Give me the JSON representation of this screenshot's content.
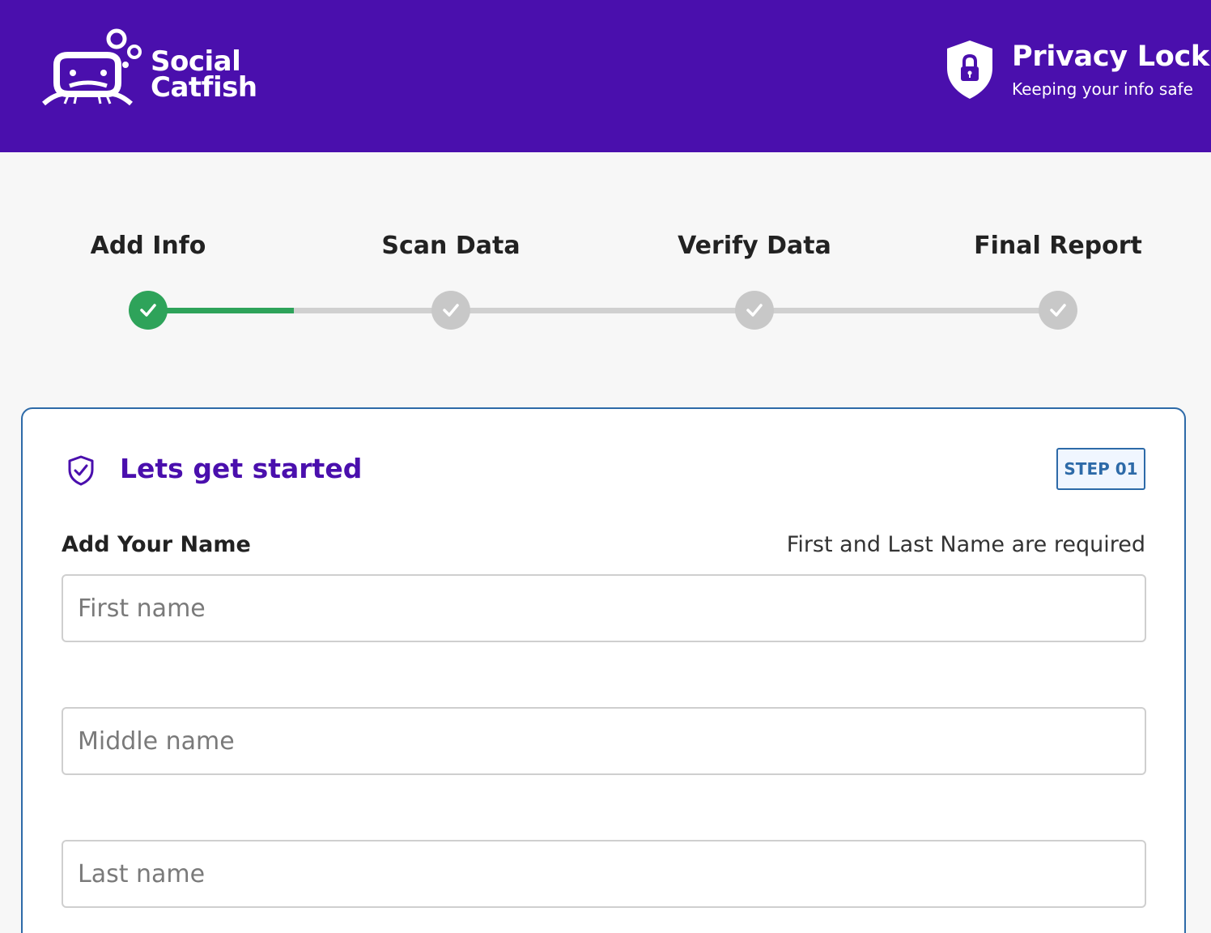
{
  "header": {
    "logo_line1": "Social",
    "logo_line2": "Catfish",
    "privacy_title": "Privacy Lock",
    "privacy_subtitle": "Keeping your info safe",
    "background": "#4a0fad"
  },
  "progress": {
    "steps": [
      {
        "label": "Add Info",
        "done": true
      },
      {
        "label": "Scan Data",
        "done": false
      },
      {
        "label": "Verify Data",
        "done": false
      },
      {
        "label": "Final Report",
        "done": false
      }
    ],
    "fill_fraction": 0.16,
    "active_color": "#2ea35a",
    "inactive_color": "#c8c8c8"
  },
  "card": {
    "title": "Lets get started",
    "title_icon": "shield-check-icon",
    "step_badge": "STEP 01",
    "section_label": "Add Your Name",
    "required_note": "First and Last Name are required",
    "fields": {
      "first_placeholder": "First name",
      "middle_placeholder": "Middle name",
      "last_placeholder": "Last name"
    }
  }
}
